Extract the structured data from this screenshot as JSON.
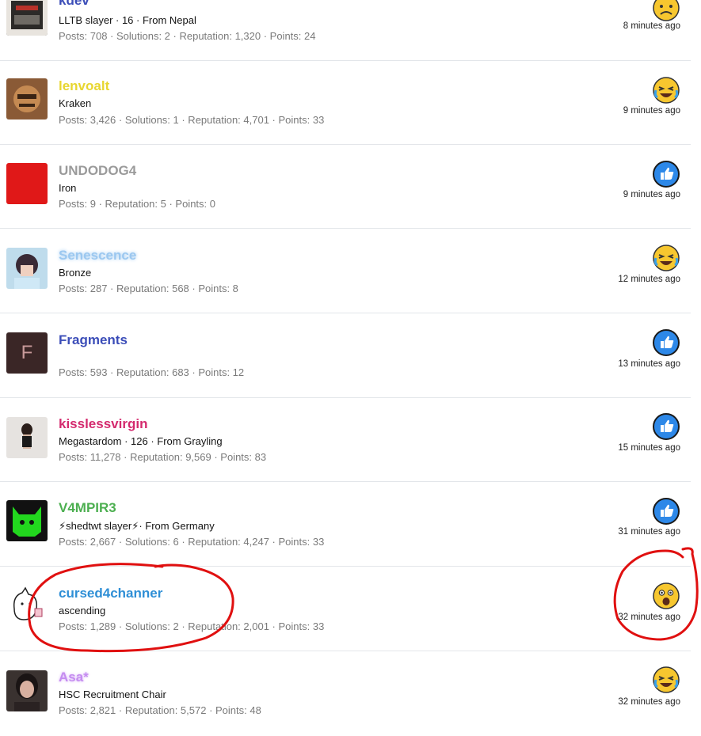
{
  "rows": [
    {
      "username": "kdev",
      "title": "LLTB slayer · 16 · From Nepal",
      "stats": "Posts: 708 · Solutions: 2 · Reputation: 1,320 · Points: 24",
      "reaction": "sad",
      "time": "8 minutes ago"
    },
    {
      "username": "lenvoalt",
      "title": "Kraken",
      "stats": "Posts: 3,426 · Solutions: 1 · Reputation: 4,701 · Points: 33",
      "reaction": "laugh",
      "time": "9 minutes ago"
    },
    {
      "username": "UNDODOG4",
      "title": "Iron",
      "stats": "Posts: 9 · Reputation: 5 · Points: 0",
      "reaction": "like",
      "time": "9 minutes ago"
    },
    {
      "username": "Senescence",
      "title": "Bronze",
      "stats": "Posts: 287 · Reputation: 568 · Points: 8",
      "reaction": "laugh",
      "time": "12 minutes ago"
    },
    {
      "username": "Fragments",
      "avatar_letter": "F",
      "title": "",
      "stats": "Posts: 593 · Reputation: 683 · Points: 12",
      "reaction": "like",
      "time": "13 minutes ago"
    },
    {
      "username": "kisslessvirgin",
      "title": "Megastardom · 126 · From Grayling",
      "stats": "Posts: 11,278 · Reputation: 9,569 · Points: 83",
      "reaction": "like",
      "time": "15 minutes ago"
    },
    {
      "username": "V4MPIR3",
      "title": "⚡shedtwt slayer⚡· From Germany",
      "stats": "Posts: 2,667 · Solutions: 6 · Reputation: 4,247 · Points: 33",
      "reaction": "like",
      "time": "31 minutes ago"
    },
    {
      "username": "cursed4channer",
      "title": "ascending",
      "stats": "Posts: 1,289 · Solutions: 2 · Reputation: 2,001 · Points: 33",
      "reaction": "wow",
      "time": "32 minutes ago"
    },
    {
      "username": "Asa*",
      "title": "HSC Recruitment Chair",
      "stats": "Posts: 2,821 · Reputation: 5,572 · Points: 48",
      "reaction": "laugh",
      "time": "32 minutes ago"
    }
  ],
  "colors": {
    "kdev": "#3b4db8",
    "lenvoalt": "#e8d630",
    "UNDODOG4": "#9a9a9a",
    "Senescence": "#9cc8f0",
    "Fragments": "#3b4db8",
    "kisslessvirgin": "#d42a6e",
    "V4MPIR3": "#4caf50",
    "cursed4channer": "#2f8fd6",
    "Asa": "#c58cf0",
    "like": "#2d88e8",
    "annotation": "#e01010"
  }
}
